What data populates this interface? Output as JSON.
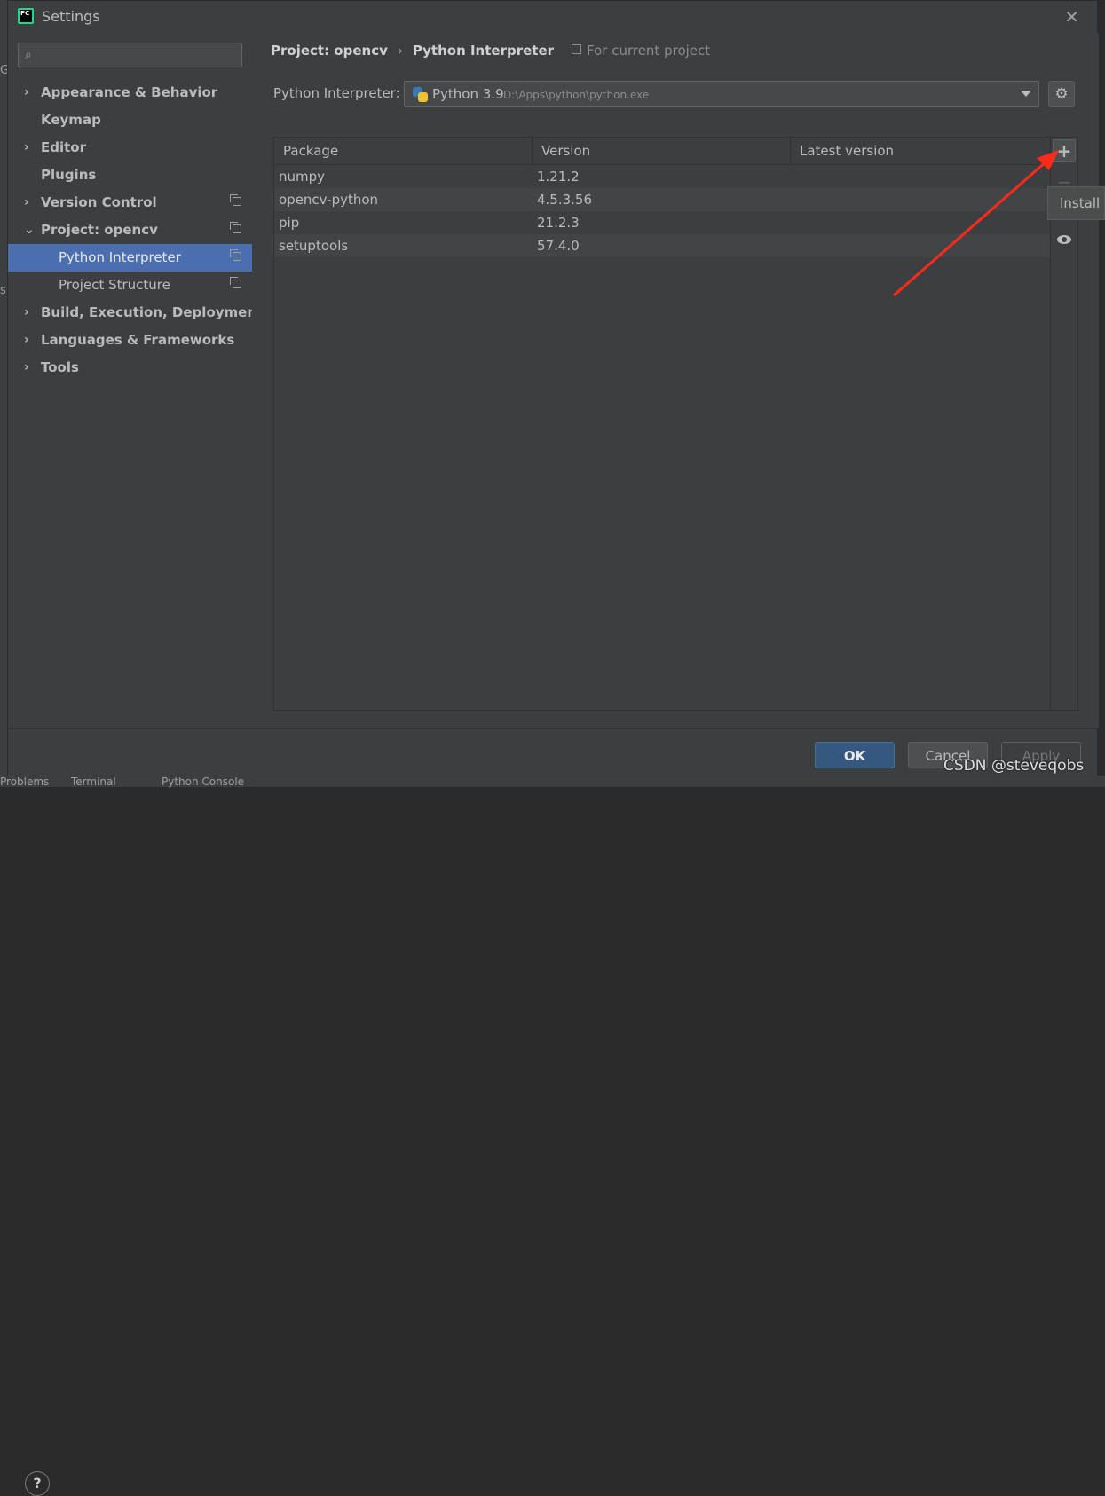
{
  "window": {
    "title": "Settings"
  },
  "background": {
    "left_edge_top": "G",
    "left_edge_mid": "s",
    "bottom_tabs": [
      "Problems",
      "Terminal",
      "Python Console"
    ]
  },
  "sidebar": {
    "search_placeholder": "",
    "items": [
      {
        "label": "Appearance & Behavior"
      },
      {
        "label": "Keymap"
      },
      {
        "label": "Editor"
      },
      {
        "label": "Plugins"
      },
      {
        "label": "Version Control"
      },
      {
        "label": "Project: opencv"
      },
      {
        "label": "Python Interpreter"
      },
      {
        "label": "Project Structure"
      },
      {
        "label": "Build, Execution, Deployment"
      },
      {
        "label": "Languages & Frameworks"
      },
      {
        "label": "Tools"
      }
    ]
  },
  "breadcrumb": {
    "parent": "Project: opencv",
    "separator": "›",
    "current": "Python Interpreter",
    "scope": "For current project"
  },
  "interpreter": {
    "label": "Python Interpreter:",
    "name": "Python 3.9",
    "path": "D:\\Apps\\python\\python.exe"
  },
  "packages": {
    "columns": [
      "Package",
      "Version",
      "Latest version"
    ],
    "rows": [
      {
        "name": "numpy",
        "version": "1.21.2",
        "latest": ""
      },
      {
        "name": "opencv-python",
        "version": "4.5.3.56",
        "latest": ""
      },
      {
        "name": "pip",
        "version": "21.2.3",
        "latest": ""
      },
      {
        "name": "setuptools",
        "version": "57.4.0",
        "latest": ""
      }
    ]
  },
  "tools": {
    "add": "+",
    "remove": "−",
    "up": "▲"
  },
  "tooltip": "Install",
  "footer": {
    "help": "?",
    "ok": "OK",
    "cancel": "Cancel",
    "apply": "Apply"
  },
  "watermark": "CSDN @steveqobs",
  "colors": {
    "accent": "#4b6eaf",
    "annotation_arrow": "#ff2a1a",
    "ok_button": "#365880"
  }
}
